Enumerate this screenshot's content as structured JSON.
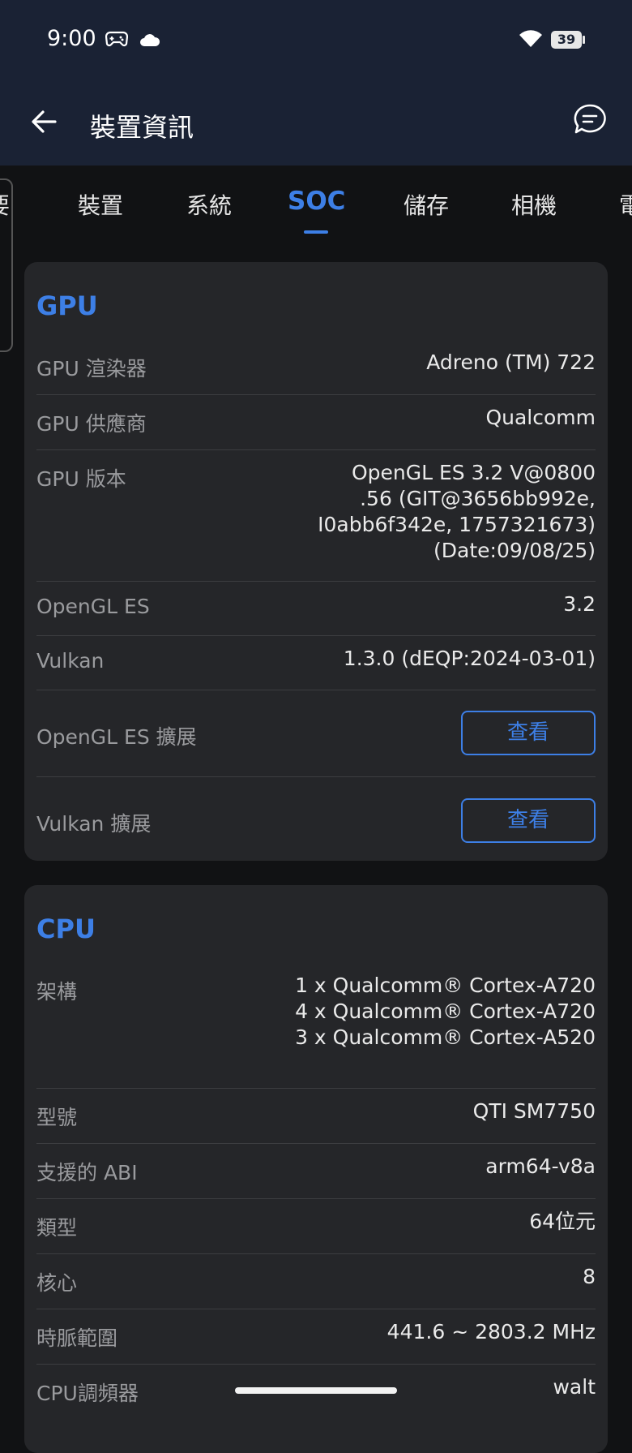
{
  "status": {
    "time": "9:00",
    "battery": "39"
  },
  "appbar": {
    "title": "裝置資訊"
  },
  "tabs": [
    "要",
    "裝置",
    "系統",
    "SOC",
    "儲存",
    "相機",
    "電"
  ],
  "gpu": {
    "title": "GPU",
    "rows": [
      {
        "label": "GPU 渲染器",
        "value": "Adreno (TM) 722"
      },
      {
        "label": "GPU 供應商",
        "value": "Qualcomm"
      },
      {
        "label": "GPU 版本",
        "value": "OpenGL ES 3.2 V@0800\n.56 (GIT@3656bb992e,\nI0abb6f342e, 1757321673)\n(Date:09/08/25)"
      },
      {
        "label": "OpenGL ES",
        "value": "3.2"
      },
      {
        "label": "Vulkan",
        "value": "1.3.0 (dEQP:2024-03-01)"
      },
      {
        "label": "OpenGL ES 擴展",
        "button": "查看"
      },
      {
        "label": "Vulkan 擴展",
        "button": "查看"
      }
    ]
  },
  "cpu": {
    "title": "CPU",
    "rows": [
      {
        "label": "架構",
        "value": "1 x Qualcomm® Cortex-A720\n4 x Qualcomm® Cortex-A720\n3 x Qualcomm® Cortex-A520"
      },
      {
        "label": "型號",
        "value": "QTI SM7750"
      },
      {
        "label": "支援的 ABI",
        "value": "arm64-v8a"
      },
      {
        "label": "類型",
        "value": "64位元"
      },
      {
        "label": "核心",
        "value": "8"
      },
      {
        "label": "時脈範圍",
        "value": "441.6 ~ 2803.2 MHz"
      },
      {
        "label": "CPU調頻器",
        "value": "walt"
      }
    ]
  }
}
